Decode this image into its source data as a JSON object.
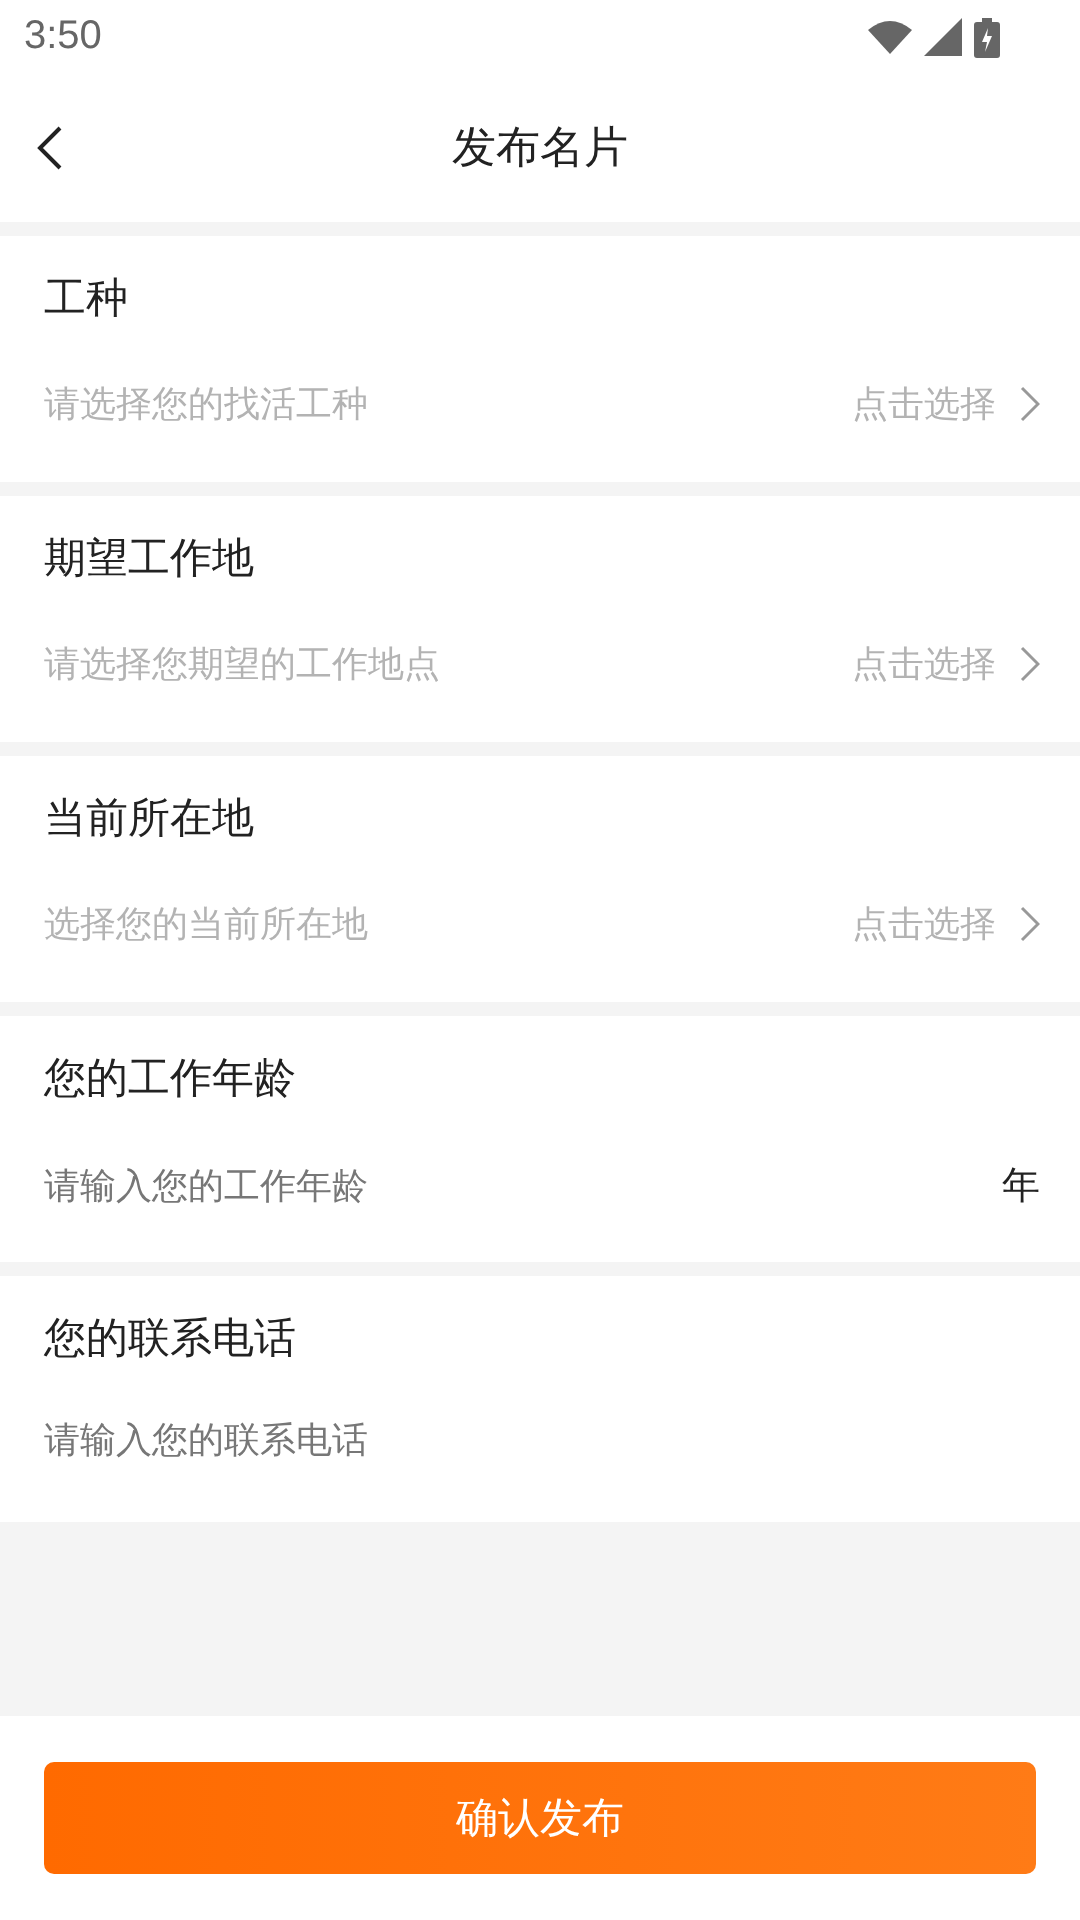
{
  "status_bar": {
    "time": "3:50"
  },
  "header": {
    "title": "发布名片"
  },
  "fields": [
    {
      "kind": "select",
      "label": "工种",
      "placeholder": "请选择您的找活工种",
      "action": "点击选择"
    },
    {
      "kind": "select",
      "label": "期望工作地",
      "placeholder": "请选择您期望的工作地点",
      "action": "点击选择"
    },
    {
      "kind": "select",
      "label": "当前所在地",
      "placeholder": "选择您的当前所在地",
      "action": "点击选择"
    },
    {
      "kind": "input",
      "label": "您的工作年龄",
      "placeholder": "请输入您的工作年龄",
      "unit": "年"
    },
    {
      "kind": "input",
      "label": "您的联系电话",
      "placeholder": "请输入您的联系电话"
    }
  ],
  "submit": "确认发布"
}
